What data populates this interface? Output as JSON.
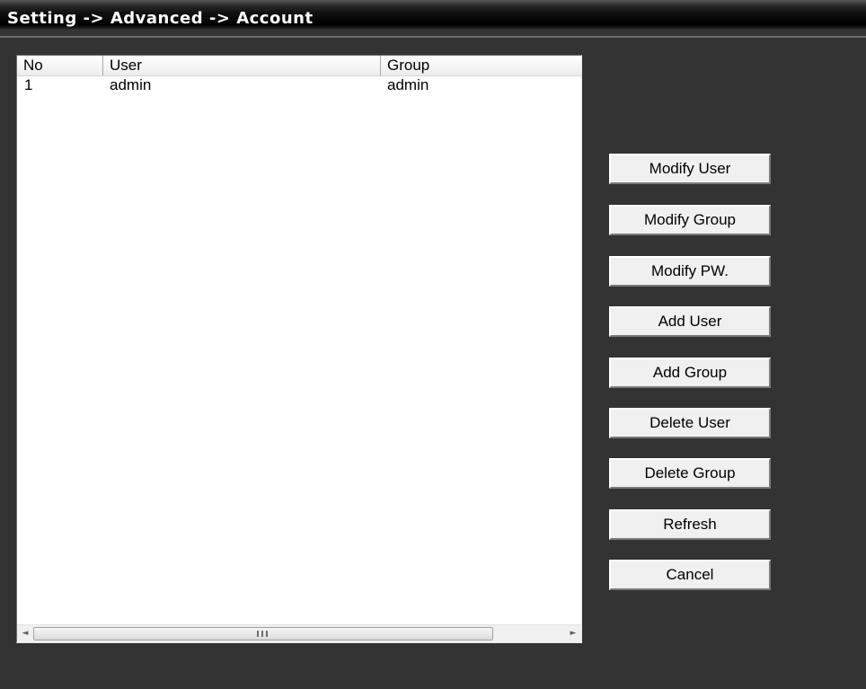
{
  "title": "Setting -> Advanced -> Account",
  "table": {
    "columns": [
      "No",
      "User",
      "Group"
    ],
    "rows": [
      {
        "no": "1",
        "user": "admin",
        "group": "admin"
      }
    ]
  },
  "scrollbar": {
    "left_arrow": "◄",
    "right_arrow": "►"
  },
  "buttons": {
    "modify_user": "Modify User",
    "modify_group": "Modify Group",
    "modify_pw": "Modify PW.",
    "add_user": "Add User",
    "add_group": "Add Group",
    "delete_user": "Delete User",
    "delete_group": "Delete Group",
    "refresh": "Refresh",
    "cancel": "Cancel"
  }
}
